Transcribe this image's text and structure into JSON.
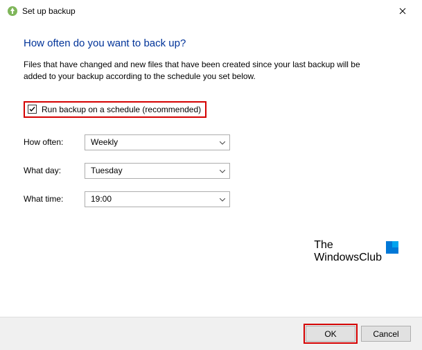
{
  "window": {
    "title": "Set up backup"
  },
  "heading": "How often do you want to back up?",
  "description": "Files that have changed and new files that have been created since your last backup will be added to your backup according to the schedule you set below.",
  "schedule_checkbox": {
    "label": "Run backup on a schedule (recommended)",
    "checked": true
  },
  "fields": {
    "how_often": {
      "label": "How often:",
      "value": "Weekly"
    },
    "what_day": {
      "label": "What day:",
      "value": "Tuesday"
    },
    "what_time": {
      "label": "What time:",
      "value": "19:00"
    }
  },
  "watermark": {
    "line1": "The",
    "line2": "WindowsClub"
  },
  "buttons": {
    "ok": "OK",
    "cancel": "Cancel"
  }
}
